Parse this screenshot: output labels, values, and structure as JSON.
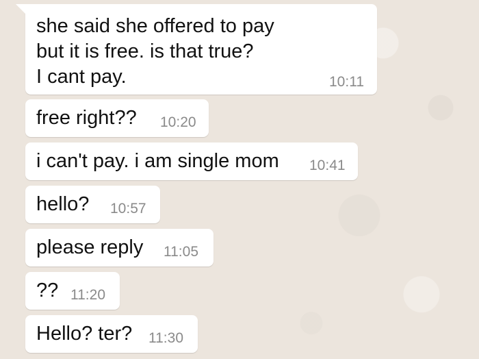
{
  "messages": [
    {
      "text": "she said she offered to pay\nbut it is free. is that true?\nI cant pay.",
      "time": "10:11"
    },
    {
      "text": "free right??",
      "time": "10:20"
    },
    {
      "text": "i can't pay. i am single mom",
      "time": "10:41"
    },
    {
      "text": "hello?",
      "time": "10:57"
    },
    {
      "text": "please reply",
      "time": "11:05"
    },
    {
      "text": "??",
      "time": "11:20"
    },
    {
      "text": "Hello? ter?",
      "time": "11:30"
    }
  ]
}
